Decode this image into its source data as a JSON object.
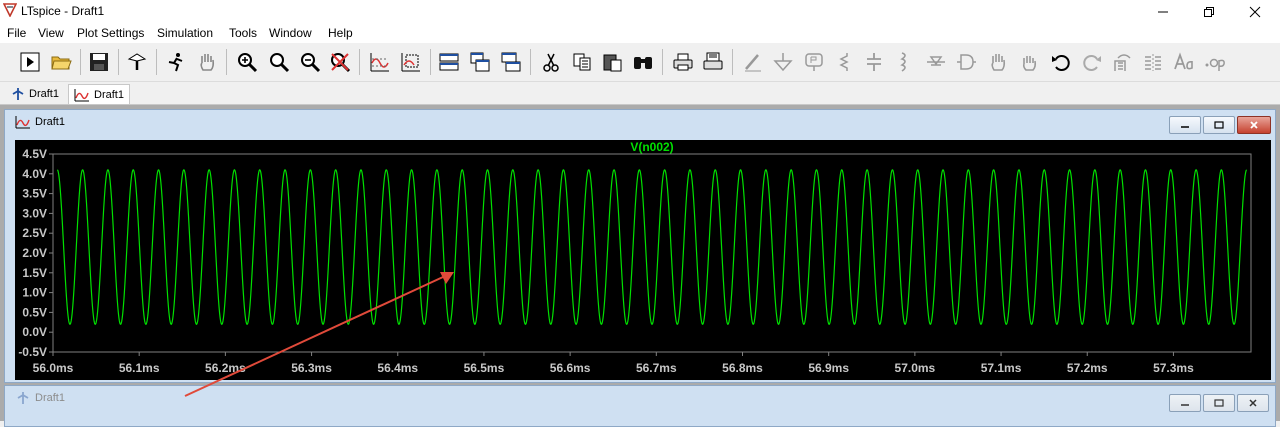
{
  "window": {
    "title": "LTspice - Draft1"
  },
  "menu": [
    "File",
    "View",
    "Plot Settings",
    "Simulation",
    "Tools",
    "Window",
    "Help"
  ],
  "toolbar_icons": [
    "run-icon",
    "open-icon",
    "save-icon",
    "control-panel-icon",
    "run-man-icon",
    "pan-hand-icon",
    "zoom-in-icon",
    "zoom-area-icon",
    "zoom-out-icon",
    "zoom-cancel-icon",
    "autorange-icon",
    "plot-settings-icon",
    "tile-horizontal-icon",
    "cascade-icon",
    "tile-vertical-icon",
    "cut-icon",
    "copy-icon",
    "paste-icon",
    "find-icon",
    "print-icon",
    "print-preview-icon",
    "wire-icon",
    "ground-icon",
    "label-icon",
    "resistor-icon",
    "capacitor-icon",
    "inductor-icon",
    "diode-icon",
    "component-icon",
    "move-icon",
    "drag-icon",
    "undo-icon",
    "redo-icon",
    "rotate-icon",
    "mirror-icon",
    "text-icon",
    "spice-directive-icon"
  ],
  "tabs": [
    {
      "label": "Draft1",
      "type": "schematic"
    },
    {
      "label": "Draft1",
      "type": "waveform"
    }
  ],
  "plot_window": {
    "title": "Draft1"
  },
  "schematic_window": {
    "title": "Draft1"
  },
  "chart_data": {
    "type": "line",
    "title": "V(n002)",
    "xlabel": "",
    "ylabel": "",
    "x_ticks": [
      "56.0ms",
      "56.1ms",
      "56.2ms",
      "56.3ms",
      "56.4ms",
      "56.5ms",
      "56.6ms",
      "56.7ms",
      "56.8ms",
      "56.9ms",
      "57.0ms",
      "57.1ms",
      "57.2ms",
      "57.3ms"
    ],
    "y_ticks": [
      "4.5V",
      "4.0V",
      "3.5V",
      "3.0V",
      "2.5V",
      "2.0V",
      "1.5V",
      "1.0V",
      "0.5V",
      "0.0V",
      "-0.5V"
    ],
    "xlim": [
      56.0,
      57.39
    ],
    "ylim": [
      -0.5,
      4.5
    ],
    "series": [
      {
        "name": "V(n002)",
        "waveform": "sine",
        "min": 0.2,
        "max": 4.1,
        "offset": 2.15,
        "amplitude": 1.95,
        "period_ms": 0.0295,
        "cycles_visible": 47,
        "color": "#00e000"
      }
    ],
    "grid": false,
    "background": "#000000",
    "frame_color": "#808080",
    "label_color": "#c8c8c8"
  },
  "annotation": {
    "type": "arrow",
    "color": "#e04a3a"
  }
}
